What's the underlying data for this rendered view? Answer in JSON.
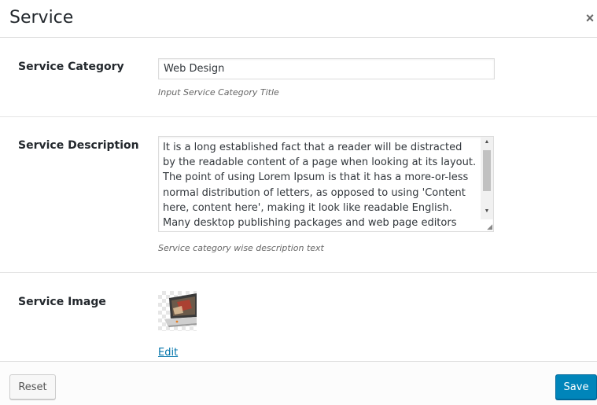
{
  "dialog": {
    "title": "Service",
    "close_glyph": "×"
  },
  "category": {
    "label": "Service Category",
    "value": "Web Design",
    "hint": "Input Service Category Title"
  },
  "description": {
    "label": "Service Description",
    "value": "It is a long established fact that a reader will be distracted by the readable content of a page when looking at its layout. The point of using Lorem Ipsum is that it has a more-or-less normal distribution of letters, as opposed to using 'Content here, content here', making it look like readable English. Many desktop publishing packages and web page editors",
    "hint": "Service category wise description text"
  },
  "image": {
    "label": "Service Image",
    "thumbnail_icon": "laptop-thumbnail-icon",
    "edit_label": "Edit"
  },
  "footer": {
    "reset_label": "Reset",
    "save_label": "Save"
  },
  "colors": {
    "primary": "#0085ba",
    "link": "#0073aa"
  }
}
